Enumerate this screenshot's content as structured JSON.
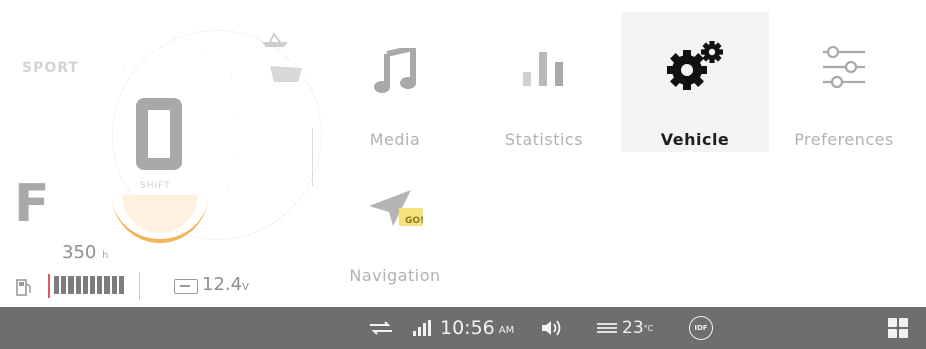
{
  "cluster": {
    "drive_mode": "SPORT",
    "gear": "0",
    "gear_caption": "SHIFT",
    "fuel_letter": "F",
    "engine_hours_value": "350",
    "engine_hours_unit": "h",
    "battery_voltage": "12.4",
    "battery_unit": "V",
    "fuel_level_fraction": 1.0,
    "accent_color": "#f2b55b"
  },
  "menu": {
    "items": [
      {
        "label": "Media",
        "icon": "music-note-icon"
      },
      {
        "label": "Statistics",
        "icon": "bar-chart-icon"
      },
      {
        "label": "Vehicle",
        "icon": "gears-icon",
        "selected": true
      },
      {
        "label": "Preferences",
        "icon": "sliders-icon"
      },
      {
        "label": "Navigation",
        "icon": "navigation-go-icon",
        "badge": "GO!"
      }
    ]
  },
  "status_bar": {
    "time": "10:56",
    "ampm": "AM",
    "temperature": "23",
    "temperature_unit": "°C",
    "profile_badge": "IDF",
    "icons": [
      "connection-icon",
      "signal-icon",
      "volume-icon",
      "heat-icon",
      "profile-icon",
      "apps-grid-icon"
    ],
    "background_color": "#6e6e6e"
  }
}
